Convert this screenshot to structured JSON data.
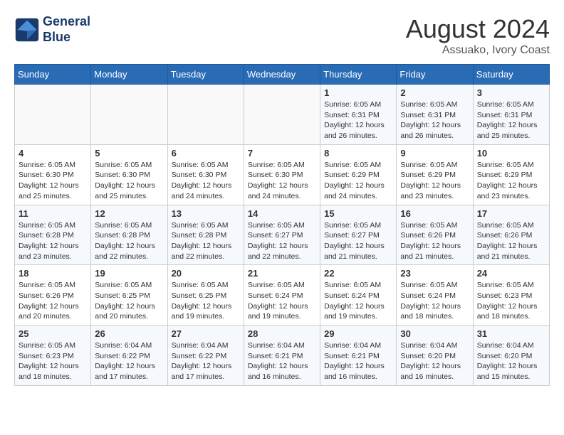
{
  "header": {
    "logo_line1": "General",
    "logo_line2": "Blue",
    "month_year": "August 2024",
    "location": "Assuako, Ivory Coast"
  },
  "weekdays": [
    "Sunday",
    "Monday",
    "Tuesday",
    "Wednesday",
    "Thursday",
    "Friday",
    "Saturday"
  ],
  "weeks": [
    [
      {
        "day": "",
        "info": ""
      },
      {
        "day": "",
        "info": ""
      },
      {
        "day": "",
        "info": ""
      },
      {
        "day": "",
        "info": ""
      },
      {
        "day": "1",
        "info": "Sunrise: 6:05 AM\nSunset: 6:31 PM\nDaylight: 12 hours\nand 26 minutes."
      },
      {
        "day": "2",
        "info": "Sunrise: 6:05 AM\nSunset: 6:31 PM\nDaylight: 12 hours\nand 26 minutes."
      },
      {
        "day": "3",
        "info": "Sunrise: 6:05 AM\nSunset: 6:31 PM\nDaylight: 12 hours\nand 25 minutes."
      }
    ],
    [
      {
        "day": "4",
        "info": "Sunrise: 6:05 AM\nSunset: 6:30 PM\nDaylight: 12 hours\nand 25 minutes."
      },
      {
        "day": "5",
        "info": "Sunrise: 6:05 AM\nSunset: 6:30 PM\nDaylight: 12 hours\nand 25 minutes."
      },
      {
        "day": "6",
        "info": "Sunrise: 6:05 AM\nSunset: 6:30 PM\nDaylight: 12 hours\nand 24 minutes."
      },
      {
        "day": "7",
        "info": "Sunrise: 6:05 AM\nSunset: 6:30 PM\nDaylight: 12 hours\nand 24 minutes."
      },
      {
        "day": "8",
        "info": "Sunrise: 6:05 AM\nSunset: 6:29 PM\nDaylight: 12 hours\nand 24 minutes."
      },
      {
        "day": "9",
        "info": "Sunrise: 6:05 AM\nSunset: 6:29 PM\nDaylight: 12 hours\nand 23 minutes."
      },
      {
        "day": "10",
        "info": "Sunrise: 6:05 AM\nSunset: 6:29 PM\nDaylight: 12 hours\nand 23 minutes."
      }
    ],
    [
      {
        "day": "11",
        "info": "Sunrise: 6:05 AM\nSunset: 6:28 PM\nDaylight: 12 hours\nand 23 minutes."
      },
      {
        "day": "12",
        "info": "Sunrise: 6:05 AM\nSunset: 6:28 PM\nDaylight: 12 hours\nand 22 minutes."
      },
      {
        "day": "13",
        "info": "Sunrise: 6:05 AM\nSunset: 6:28 PM\nDaylight: 12 hours\nand 22 minutes."
      },
      {
        "day": "14",
        "info": "Sunrise: 6:05 AM\nSunset: 6:27 PM\nDaylight: 12 hours\nand 22 minutes."
      },
      {
        "day": "15",
        "info": "Sunrise: 6:05 AM\nSunset: 6:27 PM\nDaylight: 12 hours\nand 21 minutes."
      },
      {
        "day": "16",
        "info": "Sunrise: 6:05 AM\nSunset: 6:26 PM\nDaylight: 12 hours\nand 21 minutes."
      },
      {
        "day": "17",
        "info": "Sunrise: 6:05 AM\nSunset: 6:26 PM\nDaylight: 12 hours\nand 21 minutes."
      }
    ],
    [
      {
        "day": "18",
        "info": "Sunrise: 6:05 AM\nSunset: 6:26 PM\nDaylight: 12 hours\nand 20 minutes."
      },
      {
        "day": "19",
        "info": "Sunrise: 6:05 AM\nSunset: 6:25 PM\nDaylight: 12 hours\nand 20 minutes."
      },
      {
        "day": "20",
        "info": "Sunrise: 6:05 AM\nSunset: 6:25 PM\nDaylight: 12 hours\nand 19 minutes."
      },
      {
        "day": "21",
        "info": "Sunrise: 6:05 AM\nSunset: 6:24 PM\nDaylight: 12 hours\nand 19 minutes."
      },
      {
        "day": "22",
        "info": "Sunrise: 6:05 AM\nSunset: 6:24 PM\nDaylight: 12 hours\nand 19 minutes."
      },
      {
        "day": "23",
        "info": "Sunrise: 6:05 AM\nSunset: 6:24 PM\nDaylight: 12 hours\nand 18 minutes."
      },
      {
        "day": "24",
        "info": "Sunrise: 6:05 AM\nSunset: 6:23 PM\nDaylight: 12 hours\nand 18 minutes."
      }
    ],
    [
      {
        "day": "25",
        "info": "Sunrise: 6:05 AM\nSunset: 6:23 PM\nDaylight: 12 hours\nand 18 minutes."
      },
      {
        "day": "26",
        "info": "Sunrise: 6:04 AM\nSunset: 6:22 PM\nDaylight: 12 hours\nand 17 minutes."
      },
      {
        "day": "27",
        "info": "Sunrise: 6:04 AM\nSunset: 6:22 PM\nDaylight: 12 hours\nand 17 minutes."
      },
      {
        "day": "28",
        "info": "Sunrise: 6:04 AM\nSunset: 6:21 PM\nDaylight: 12 hours\nand 16 minutes."
      },
      {
        "day": "29",
        "info": "Sunrise: 6:04 AM\nSunset: 6:21 PM\nDaylight: 12 hours\nand 16 minutes."
      },
      {
        "day": "30",
        "info": "Sunrise: 6:04 AM\nSunset: 6:20 PM\nDaylight: 12 hours\nand 16 minutes."
      },
      {
        "day": "31",
        "info": "Sunrise: 6:04 AM\nSunset: 6:20 PM\nDaylight: 12 hours\nand 15 minutes."
      }
    ]
  ]
}
